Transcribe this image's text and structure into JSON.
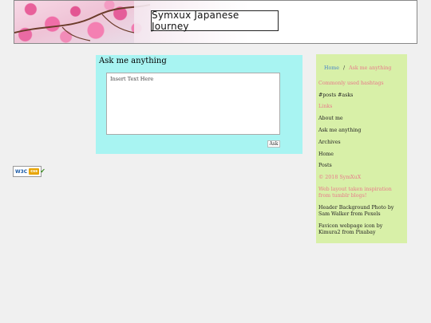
{
  "header": {
    "site_title": "Symxux Japanese Journey",
    "image": "cherry-blossom-header"
  },
  "main": {
    "heading": "Ask me anything",
    "ask_placeholder": "Insert Text Here",
    "ask_button": "Ask"
  },
  "badge": {
    "w3c": "W3C",
    "css": "css"
  },
  "sidebar": {
    "breadcrumb": {
      "home": "Home",
      "separator": "/",
      "current": "Ask me anything"
    },
    "items": [
      {
        "label": "Commonly used hashtags",
        "color": "pink"
      },
      {
        "label": "#posts #asks",
        "color": "dark"
      },
      {
        "label": "Links",
        "color": "pink"
      },
      {
        "label": "About me",
        "color": "dark"
      },
      {
        "label": "Ask me anything",
        "color": "dark"
      },
      {
        "label": "Archives",
        "color": "dark"
      },
      {
        "label": "Home",
        "color": "dark"
      },
      {
        "label": "Posts",
        "color": "dark"
      },
      {
        "label": "© 2018 SymXuX",
        "color": "pink"
      },
      {
        "label": "Web layout taken inspiration from tumblr blogs!",
        "color": "pink"
      },
      {
        "label": "Header Background Photo by Sam Walker from Pexels",
        "color": "dark"
      },
      {
        "label": "Favicon webpage icon by Kimura2 from Pixabay",
        "color": "dark"
      }
    ]
  },
  "colors": {
    "main_bg": "#a8f4f2",
    "sidebar_bg": "#d8f0a8",
    "accent_pink": "#e87a8a",
    "link_blue": "#4a86c7"
  }
}
